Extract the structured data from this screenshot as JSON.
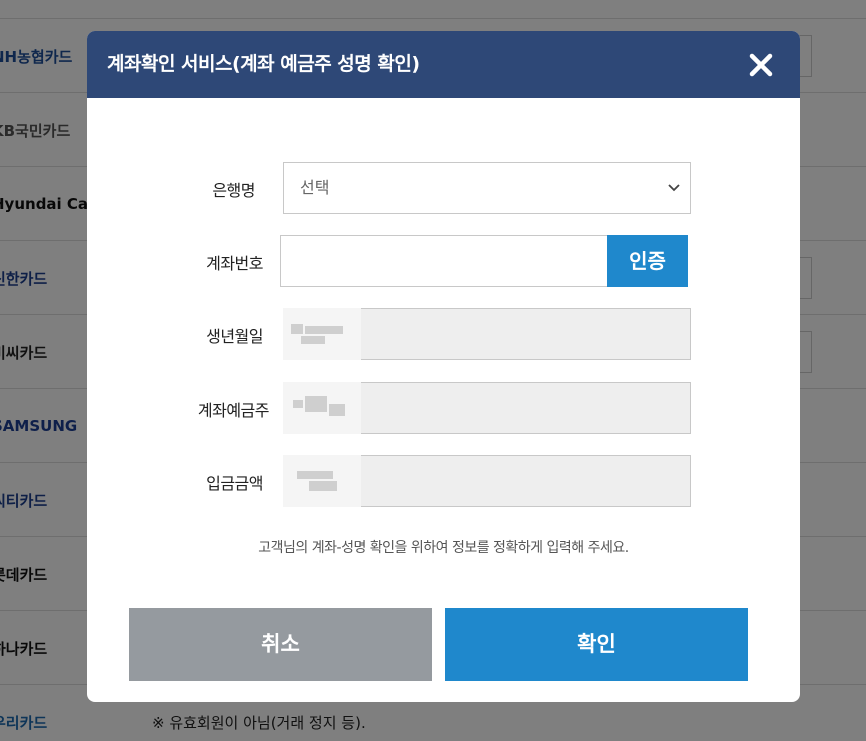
{
  "background": {
    "cards": [
      {
        "label": "NH농협카드",
        "color": "#1f4f9a",
        "mini_input": true
      },
      {
        "label": "KB국민카드",
        "color": "#555555",
        "mini_input": false
      },
      {
        "label": "Hyundai Card",
        "color": "#111111",
        "mini_input": false
      },
      {
        "label": "신한카드",
        "color": "#1c3f8f",
        "mini_input": true
      },
      {
        "label": "비씨카드",
        "color": "#222222",
        "mini_input": true
      },
      {
        "label": "SAMSUNG",
        "color": "#1d3f95",
        "mini_input": false
      },
      {
        "label": "씨티카드",
        "color": "#1c3f8f",
        "mini_input": false
      },
      {
        "label": "롯데카드",
        "color": "#111111",
        "mini_input": false
      },
      {
        "label": "하나카드",
        "color": "#111111",
        "mini_input": false
      },
      {
        "label": "우리카드",
        "color": "#1c6ab0",
        "mini_input": false
      }
    ],
    "note": "※ 유효회원이 아님(거래 정지 등)."
  },
  "modal": {
    "title": "계좌확인 서비스(계좌 예금주 성명 확인)",
    "close_icon": "close-x-icon",
    "fields": {
      "bank": {
        "label": "은행명",
        "value": "선택"
      },
      "account": {
        "label": "계좌번호",
        "value": "",
        "auth_button": "인증"
      },
      "birth": {
        "label": "생년월일"
      },
      "holder": {
        "label": "계좌예금주"
      },
      "amount": {
        "label": "입금금액"
      }
    },
    "helper_text": "고객님의 계좌-성명 확인을 위하여 정보를 정확하게 입력해 주세요.",
    "cancel_label": "취소",
    "confirm_label": "확인"
  },
  "colors": {
    "header": "#2e4877",
    "primary": "#1f88cc",
    "cancel": "#959a9f"
  }
}
